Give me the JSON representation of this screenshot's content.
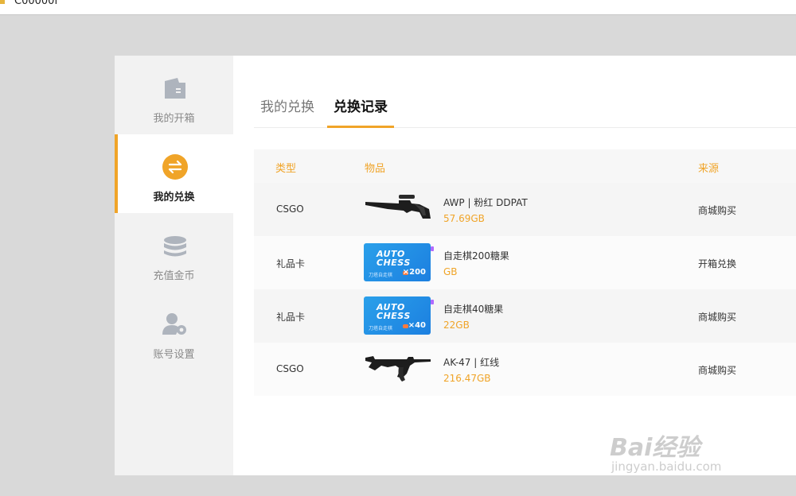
{
  "titlebar": {
    "title": "C00000f"
  },
  "sidebar": {
    "items": [
      {
        "label": "我的开箱",
        "icon": "box-icon",
        "active": false
      },
      {
        "label": "我的兑换",
        "icon": "exchange-icon",
        "active": true
      },
      {
        "label": "充值金币",
        "icon": "coins-icon",
        "active": false
      },
      {
        "label": "账号设置",
        "icon": "user-settings-icon",
        "active": false
      }
    ]
  },
  "tabs": [
    {
      "label": "我的兑换",
      "active": false
    },
    {
      "label": "兑换记录",
      "active": true
    }
  ],
  "table": {
    "headers": {
      "type": "类型",
      "item": "物品",
      "source": "来源"
    },
    "rows": [
      {
        "type": "CSGO",
        "name": "AWP | 粉红 DDPAT",
        "price": "57.69GB",
        "source": "商城购买",
        "image": "awp-rifle-icon"
      },
      {
        "type": "礼品卡",
        "name": "自走棋200糖果",
        "price": "GB",
        "source": "开箱兑换",
        "image": "auto-chess-card-icon",
        "card": {
          "logo1": "AUTO",
          "logo2": "CHESS",
          "small": "刀塔自走棋",
          "qty": "×200"
        }
      },
      {
        "type": "礼品卡",
        "name": "自走棋40糖果",
        "price": "22GB",
        "source": "商城购买",
        "image": "auto-chess-card-icon",
        "card": {
          "logo1": "AUTO",
          "logo2": "CHESS",
          "small": "刀塔自走棋",
          "qty": "×40"
        }
      },
      {
        "type": "CSGO",
        "name": "AK-47 | 红线",
        "price": "216.47GB",
        "source": "商城购买",
        "image": "ak47-rifle-icon"
      }
    ]
  },
  "watermark": {
    "brand": "Bai经验",
    "sub": "jingyan.baidu.com"
  },
  "colors": {
    "accent": "#f0a428",
    "background": "#d9d9d9"
  }
}
